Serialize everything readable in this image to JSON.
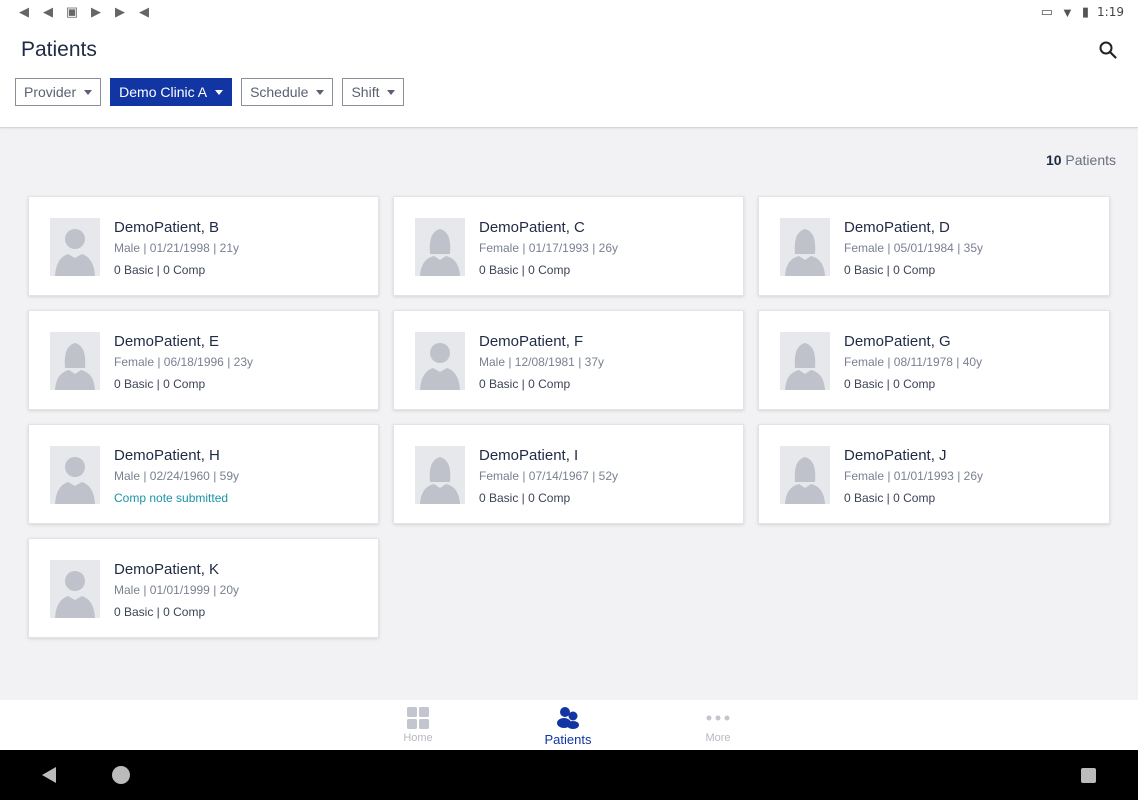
{
  "status_bar": {
    "time": "1:19",
    "notification_icons": [
      "send-icon",
      "send-icon",
      "image-icon",
      "play-store-icon",
      "play-store-icon",
      "send-icon"
    ],
    "system_icons": [
      "cast-icon",
      "wifi-icon",
      "battery-icon"
    ]
  },
  "header": {
    "title": "Patients",
    "filters": [
      {
        "label": "Provider",
        "active": false
      },
      {
        "label": "Demo Clinic A",
        "active": true
      },
      {
        "label": "Schedule",
        "active": false
      },
      {
        "label": "Shift",
        "active": false
      }
    ]
  },
  "summary": {
    "count": "10",
    "count_label": "Patients"
  },
  "patients": [
    {
      "name": "DemoPatient, B",
      "info": "Male | 01/21/1998 | 21y",
      "notes": "0 Basic | 0 Comp",
      "gender": "male",
      "comp_submitted": false
    },
    {
      "name": "DemoPatient, C",
      "info": "Female | 01/17/1993 | 26y",
      "notes": "0 Basic | 0 Comp",
      "gender": "female",
      "comp_submitted": false
    },
    {
      "name": "DemoPatient, D",
      "info": "Female | 05/01/1984 | 35y",
      "notes": "0 Basic | 0 Comp",
      "gender": "female",
      "comp_submitted": false
    },
    {
      "name": "DemoPatient, E",
      "info": "Female | 06/18/1996 | 23y",
      "notes": "0 Basic | 0 Comp",
      "gender": "female",
      "comp_submitted": false
    },
    {
      "name": "DemoPatient, F",
      "info": "Male | 12/08/1981 | 37y",
      "notes": "0 Basic | 0 Comp",
      "gender": "male",
      "comp_submitted": false
    },
    {
      "name": "DemoPatient, G",
      "info": "Female | 08/11/1978 | 40y",
      "notes": "0 Basic | 0 Comp",
      "gender": "female",
      "comp_submitted": false
    },
    {
      "name": "DemoPatient, H",
      "info": "Male | 02/24/1960 | 59y",
      "notes": "Comp note submitted",
      "gender": "male",
      "comp_submitted": true
    },
    {
      "name": "DemoPatient, I",
      "info": "Female | 07/14/1967 | 52y",
      "notes": "0 Basic | 0 Comp",
      "gender": "female",
      "comp_submitted": false
    },
    {
      "name": "DemoPatient, J",
      "info": "Female | 01/01/1993 | 26y",
      "notes": "0 Basic | 0 Comp",
      "gender": "female",
      "comp_submitted": false
    },
    {
      "name": "DemoPatient, K",
      "info": "Male | 01/01/1999 | 20y",
      "notes": "0 Basic | 0 Comp",
      "gender": "male",
      "comp_submitted": false
    }
  ],
  "bottom_nav": {
    "items": [
      {
        "label": "Home",
        "icon": "grid-icon",
        "active": false
      },
      {
        "label": "Patients",
        "icon": "patients-icon",
        "active": true
      },
      {
        "label": "More",
        "icon": "more-icon",
        "active": false
      }
    ]
  },
  "colors": {
    "accent": "#1136a3",
    "comp_note": "#1a94a6",
    "background": "#f2f2f4"
  }
}
